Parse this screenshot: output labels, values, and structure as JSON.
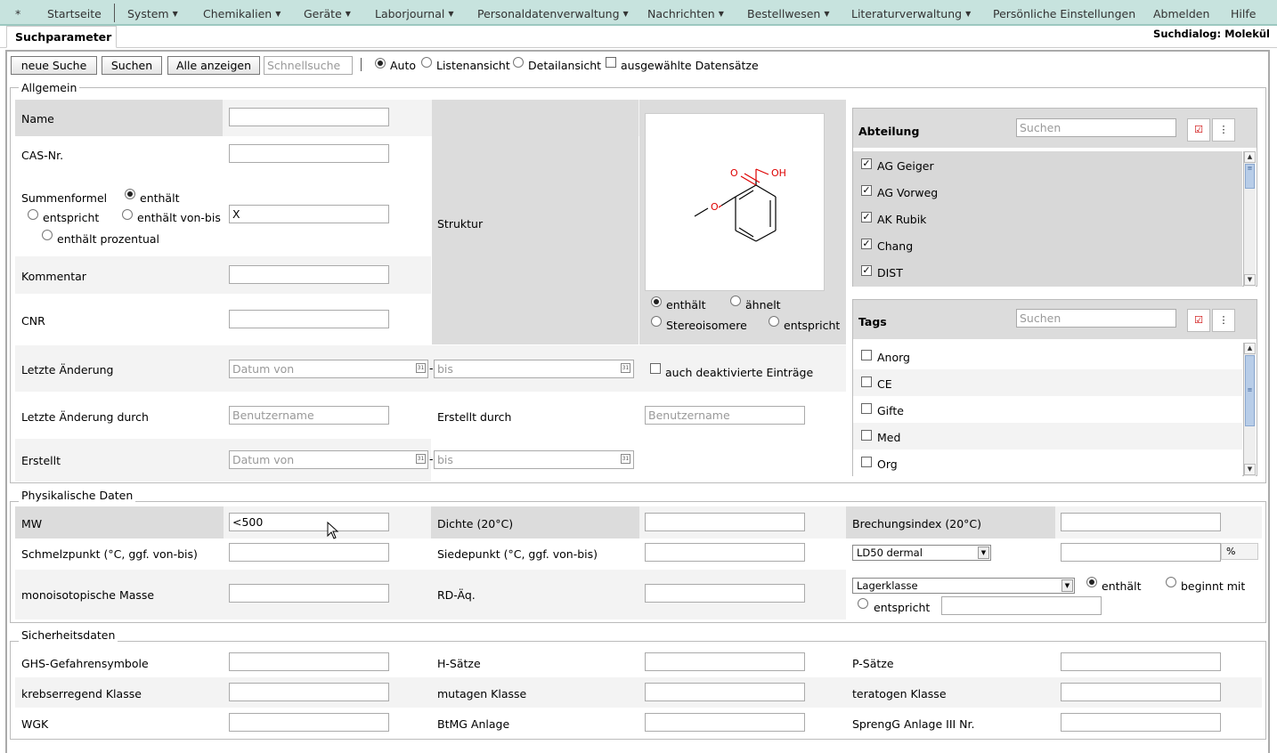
{
  "menu": {
    "star": "*",
    "items": [
      {
        "label": "Startseite",
        "caret": false
      },
      {
        "label": "System",
        "caret": true
      },
      {
        "label": "Chemikalien",
        "caret": true
      },
      {
        "label": "Geräte",
        "caret": true
      },
      {
        "label": "Laborjournal",
        "caret": true
      },
      {
        "label": "Personaldatenverwaltung",
        "caret": true
      },
      {
        "label": "Nachrichten",
        "caret": true
      },
      {
        "label": "Bestellwesen",
        "caret": true
      },
      {
        "label": "Literaturverwaltung",
        "caret": true
      },
      {
        "label": "Persönliche Einstellungen",
        "caret": false
      },
      {
        "label": "Abmelden",
        "caret": false
      },
      {
        "label": "Hilfe",
        "caret": false
      }
    ]
  },
  "tab": "Suchparameter",
  "dialog_title": "Suchdialog: Molekül",
  "toolbar": {
    "new_search": "neue Suche",
    "search": "Suchen",
    "show_all": "Alle anzeigen",
    "quick_search_placeholder": "Schnellsuche",
    "auto": "Auto",
    "list_view": "Listenansicht",
    "detail_view": "Detailansicht",
    "selected_records": "ausgewählte Datensätze"
  },
  "general": {
    "legend": "Allgemein",
    "name": "Name",
    "cas": "CAS-Nr.",
    "formula": "Summenformel",
    "formula_contains": "enthält",
    "formula_equals": "entspricht",
    "formula_range": "enthält von-bis",
    "formula_percent": "enthält prozentual",
    "formula_value": "X",
    "comment": "Kommentar",
    "cnr": "CNR",
    "last_change": "Letzte Änderung",
    "date_from_placeholder": "Datum von",
    "date_to_placeholder": "bis",
    "last_change_by": "Letzte Änderung durch",
    "username_placeholder": "Benutzername",
    "created": "Erstellt",
    "created_by": "Erstellt durch",
    "include_deactivated": "auch deaktivierte Einträge",
    "structure": "Struktur",
    "structure_contains": "enthält",
    "structure_similar": "ähnelt",
    "structure_stereo": "Stereoisomere",
    "structure_equals": "entspricht",
    "molecule_atoms": {
      "o_carbonyl": "O",
      "oh": "OH",
      "o_methoxy": "O"
    }
  },
  "department": {
    "title": "Abteilung",
    "search_placeholder": "Suchen",
    "items": [
      {
        "label": "AG Geiger",
        "checked": true
      },
      {
        "label": "AG Vorweg",
        "checked": true
      },
      {
        "label": "AK Rubik",
        "checked": true
      },
      {
        "label": "Chang",
        "checked": true
      },
      {
        "label": "DIST",
        "checked": true
      }
    ]
  },
  "tags": {
    "title": "Tags",
    "search_placeholder": "Suchen",
    "items": [
      {
        "label": "Anorg",
        "checked": false
      },
      {
        "label": "CE",
        "checked": false
      },
      {
        "label": "Gifte",
        "checked": false
      },
      {
        "label": "Med",
        "checked": false
      },
      {
        "label": "Org",
        "checked": false
      }
    ]
  },
  "physical": {
    "legend": "Physikalische Daten",
    "mw": "MW",
    "mw_value": "<500",
    "density": "Dichte (20°C)",
    "refractive": "Brechungsindex (20°C)",
    "melting": "Schmelzpunkt (°C, ggf. von-bis)",
    "boiling": "Siedepunkt (°C, ggf. von-bis)",
    "ld50_select": "LD50 dermal",
    "percent": "%",
    "mono_mass": "monoisotopische Masse",
    "rd": "RD-Äq.",
    "storage_select": "Lagerklasse",
    "storage_contains": "enthält",
    "storage_begins": "beginnt mit",
    "storage_equals": "entspricht"
  },
  "safety": {
    "legend": "Sicherheitsdaten",
    "ghs": "GHS-Gefahrensymbole",
    "h": "H-Sätze",
    "p": "P-Sätze",
    "carcinogenic": "krebserregend Klasse",
    "mutagenic": "mutagen Klasse",
    "teratogenic": "teratogen Klasse",
    "wgk": "WGK",
    "btmg": "BtMG Anlage",
    "sprengg": "SprengG Anlage III Nr."
  }
}
